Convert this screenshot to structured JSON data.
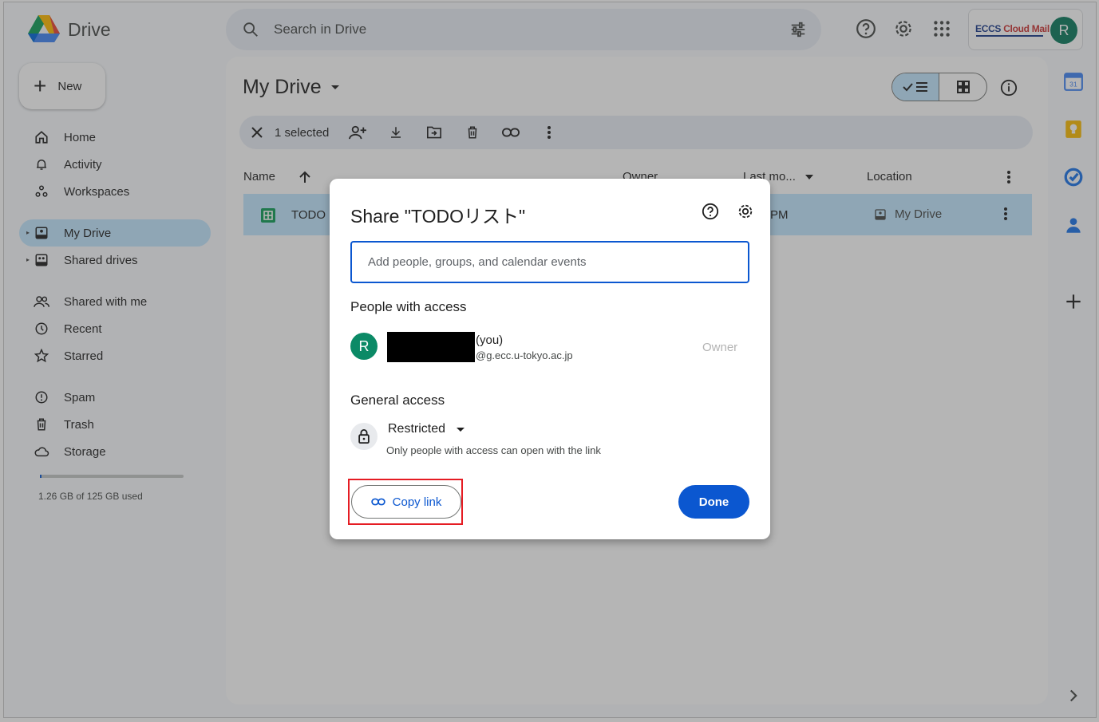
{
  "app": {
    "name": "Drive"
  },
  "search": {
    "placeholder": "Search in Drive"
  },
  "account": {
    "brand_part1": "ECCS",
    "brand_part2": "Cloud Mail",
    "avatar_initial": "R"
  },
  "sidebar": {
    "new_label": "New",
    "items": [
      {
        "label": "Home",
        "icon": "home-icon"
      },
      {
        "label": "Activity",
        "icon": "bell-icon"
      },
      {
        "label": "Workspaces",
        "icon": "workspaces-icon"
      },
      {
        "label": "My Drive",
        "icon": "my-drive-icon",
        "active": true
      },
      {
        "label": "Shared drives",
        "icon": "shared-drives-icon"
      },
      {
        "label": "Shared with me",
        "icon": "people-icon"
      },
      {
        "label": "Recent",
        "icon": "clock-icon"
      },
      {
        "label": "Starred",
        "icon": "star-icon"
      },
      {
        "label": "Spam",
        "icon": "spam-icon"
      },
      {
        "label": "Trash",
        "icon": "trash-icon"
      },
      {
        "label": "Storage",
        "icon": "cloud-icon"
      }
    ],
    "storage_text": "1.26 GB of 125 GB used",
    "storage_fraction": 0.01
  },
  "main": {
    "title": "My Drive",
    "selection": {
      "count_label": "1 selected"
    },
    "columns": {
      "name": "Name",
      "owner": "Owner",
      "modified": "Last mo...",
      "location": "Location"
    },
    "rows": [
      {
        "name": "TODO",
        "modified": "PM",
        "location": "My Drive"
      }
    ]
  },
  "dialog": {
    "title": "Share \"TODOリスト\"",
    "input_placeholder": "Add people, groups, and calendar events",
    "people_heading": "People with access",
    "person": {
      "initial": "R",
      "you_label": "(you)",
      "email": "@g.ecc.u-tokyo.ac.jp",
      "role": "Owner"
    },
    "general_heading": "General access",
    "access_level": "Restricted",
    "access_desc": "Only people with access can open with the link",
    "copy_label": "Copy link",
    "done_label": "Done"
  },
  "colors": {
    "accent": "#0b57d0",
    "selected_bg": "#c2e7ff",
    "highlight_box": "#e51c23",
    "avatar": "#0b7a5c"
  }
}
